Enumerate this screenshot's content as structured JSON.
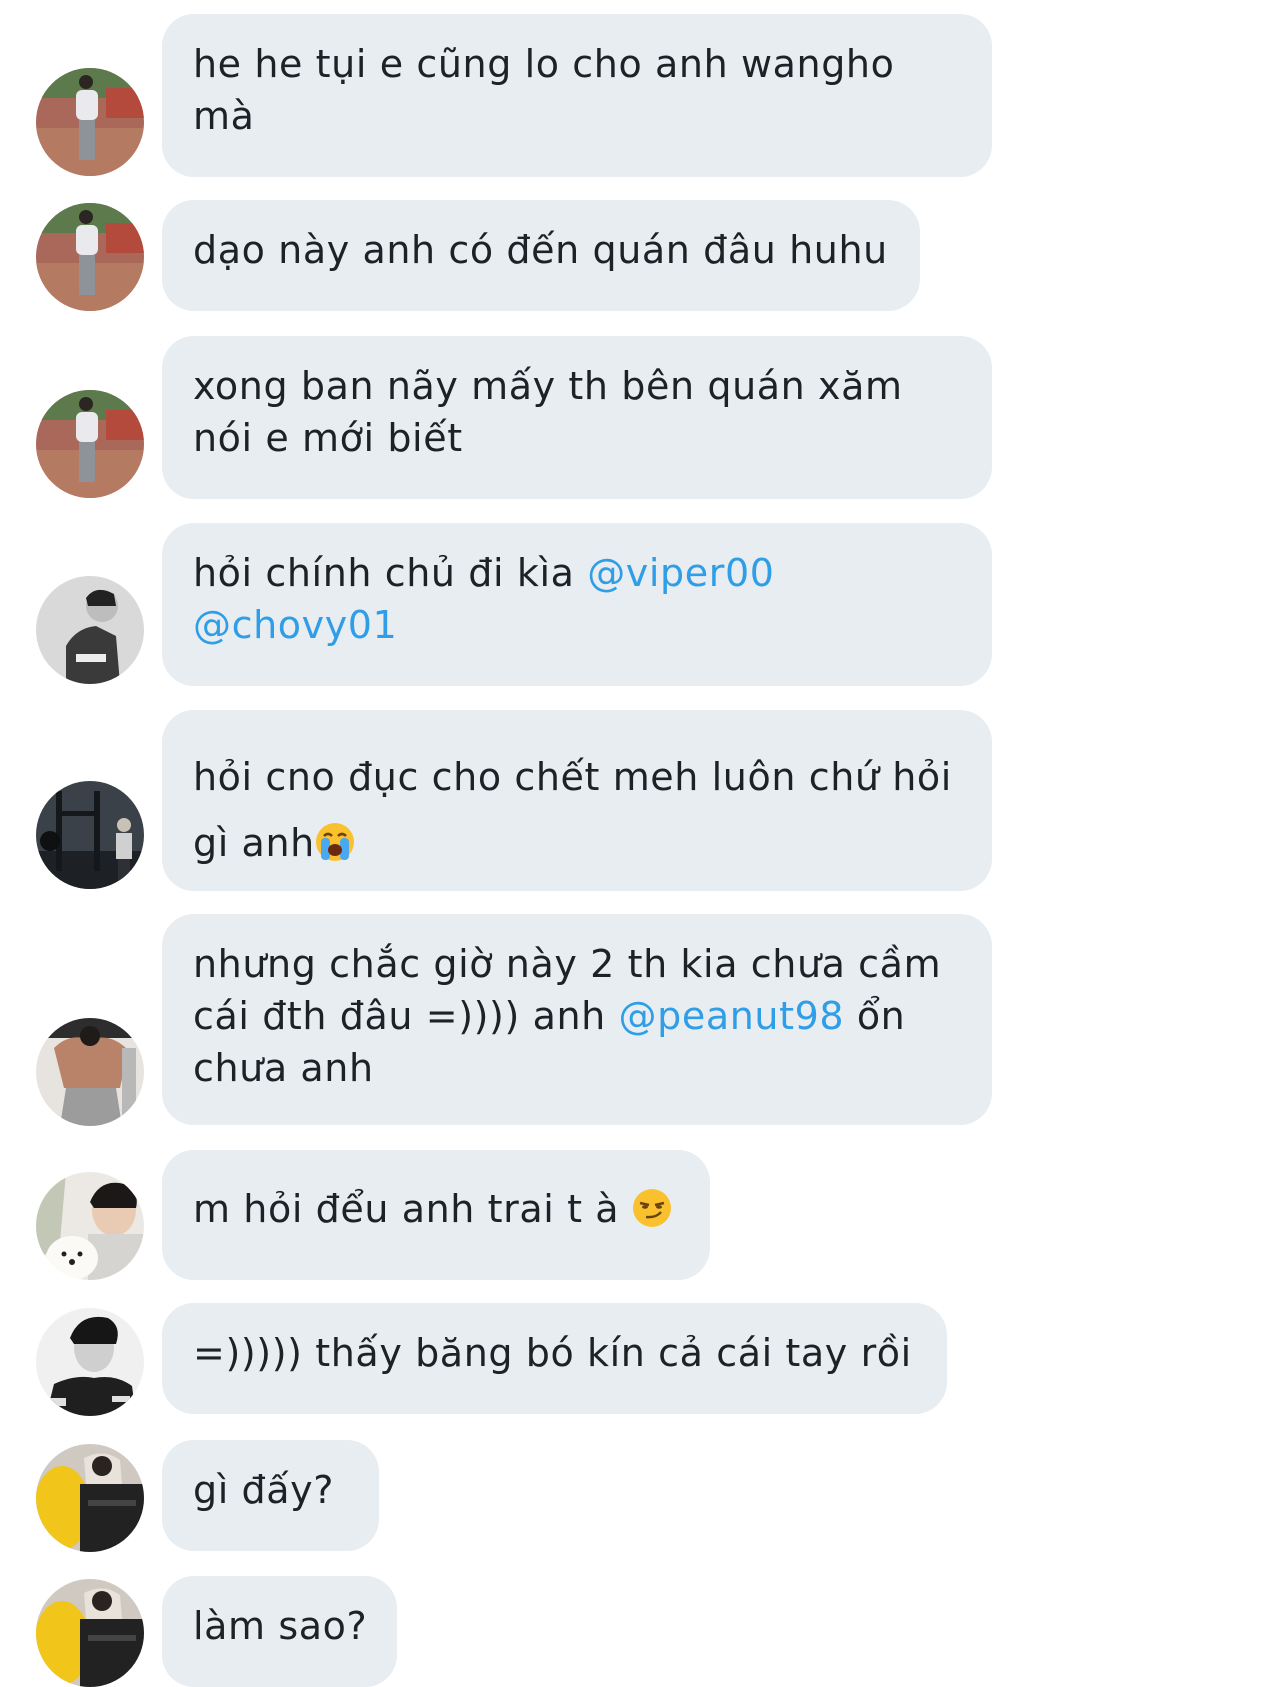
{
  "messages": [
    {
      "avatar": "avatar-photo-courtyard",
      "lines": [
        "he he tụi e cũng lo cho anh wangho",
        "mà"
      ]
    },
    {
      "avatar": "avatar-photo-courtyard",
      "lines": [
        "dạo này anh có đến quán đâu huhu"
      ]
    },
    {
      "avatar": "avatar-photo-courtyard",
      "lines": [
        "xong ban nãy mấy th bên quán xăm",
        "nói e mới biết"
      ]
    },
    {
      "avatar": "avatar-photo-profile-bw",
      "line1_text": "hỏi chính chủ đi kìa ",
      "mention1": "@viper00",
      "mention2": "@chovy01"
    },
    {
      "avatar": "avatar-photo-gym",
      "line1": "hỏi cno đục cho chết meh luôn chứ hỏi",
      "line2_text": "gì anh",
      "emoji": "loudly-crying-face"
    },
    {
      "avatar": "avatar-photo-back-flex",
      "line1": "nhưng chắc giờ này 2 th kia chưa cầm",
      "line2_text1": "cái đth đâu =)))) anh ",
      "mention": "@peanut98",
      "line2_text2": " ổn",
      "line3": "chưa anh"
    },
    {
      "avatar": "avatar-photo-with-dog",
      "text": "m hỏi đểu anh trai t à ",
      "emoji": "smirking-face"
    },
    {
      "avatar": "avatar-photo-bw-jersey",
      "lines": [
        "=))))) thấy băng bó kín cả cái tay rồi"
      ]
    },
    {
      "avatar": "avatar-photo-yellow-chair",
      "lines": [
        "gì đấy?"
      ]
    },
    {
      "avatar": "avatar-photo-yellow-chair",
      "lines": [
        "làm sao?"
      ]
    }
  ],
  "colors": {
    "bubble": "#e8edf2",
    "text": "#1e2126",
    "mention": "#2f9ee6"
  }
}
